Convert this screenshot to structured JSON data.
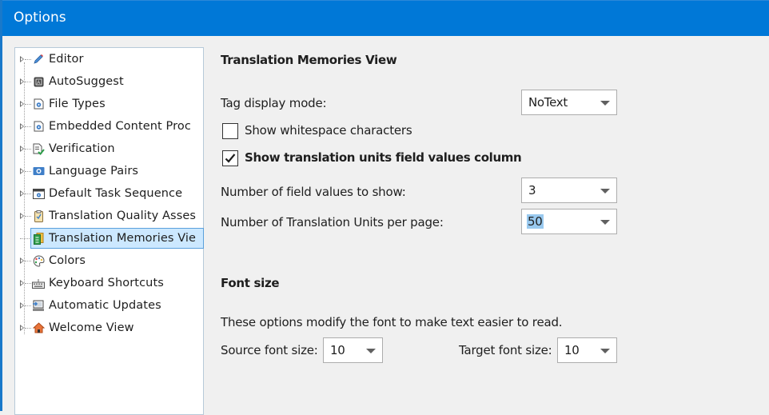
{
  "window": {
    "title": "Options"
  },
  "tree": {
    "items": [
      {
        "label": "Editor",
        "icon": "pencil-icon",
        "selected": false
      },
      {
        "label": "AutoSuggest",
        "icon": "autosuggest-icon",
        "selected": false
      },
      {
        "label": "File Types",
        "icon": "file-gear-icon",
        "selected": false
      },
      {
        "label": "Embedded Content Proc",
        "icon": "file-gear-icon",
        "selected": false
      },
      {
        "label": "Verification",
        "icon": "document-check-icon",
        "selected": false
      },
      {
        "label": "Language Pairs",
        "icon": "language-pairs-icon",
        "selected": false
      },
      {
        "label": "Default Task Sequence",
        "icon": "window-gear-icon",
        "selected": false
      },
      {
        "label": "Translation Quality Asses",
        "icon": "clipboard-check-icon",
        "selected": false
      },
      {
        "label": "Translation Memories Vie",
        "icon": "translation-memory-icon",
        "selected": true
      },
      {
        "label": "Colors",
        "icon": "palette-icon",
        "selected": false
      },
      {
        "label": "Keyboard Shortcuts",
        "icon": "keyboard-icon",
        "selected": false
      },
      {
        "label": "Automatic Updates",
        "icon": "computer-update-icon",
        "selected": false
      },
      {
        "label": "Welcome View",
        "icon": "home-icon",
        "selected": false
      }
    ]
  },
  "panel": {
    "heading": "Translation Memories View",
    "tag_display_mode": {
      "label": "Tag display mode:",
      "value": "NoText"
    },
    "show_whitespace": {
      "label": "Show whitespace characters",
      "checked": false
    },
    "show_field_values_column": {
      "label": "Show translation units field values column",
      "checked": true
    },
    "field_values_count": {
      "label": "Number of field values to show:",
      "value": "3"
    },
    "units_per_page": {
      "label": "Number of Translation Units per page:",
      "value": "50"
    },
    "font_section": {
      "heading": "Font size",
      "description": "These options modify the font to make text easier to read.",
      "source": {
        "label": "Source font size:",
        "value": "10"
      },
      "target": {
        "label": "Target font size:",
        "value": "10"
      }
    }
  }
}
